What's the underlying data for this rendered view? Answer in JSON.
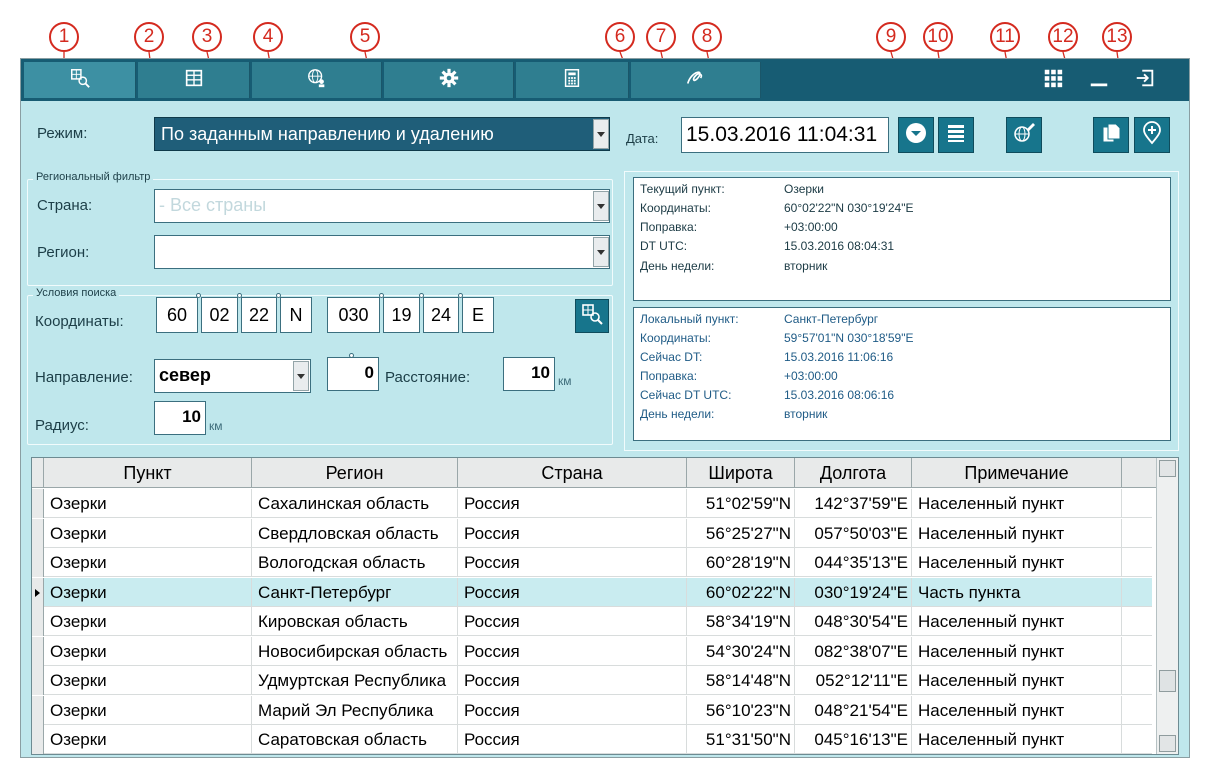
{
  "callouts": [
    "1",
    "2",
    "3",
    "4",
    "5",
    "6",
    "7",
    "8",
    "9",
    "10",
    "11",
    "12",
    "13"
  ],
  "toolbar": {
    "tabs": [
      {
        "icon": "map-search-icon",
        "active": true
      },
      {
        "icon": "table-grid-icon",
        "active": false
      },
      {
        "icon": "globe-person-icon",
        "active": false
      },
      {
        "icon": "gear-icon",
        "active": false
      },
      {
        "icon": "calculator-icon",
        "active": false
      },
      {
        "icon": "signature-icon",
        "active": false
      }
    ],
    "right": [
      "apps-grid-icon",
      "minimize-icon",
      "exit-icon"
    ]
  },
  "mode": {
    "label": "Режим:",
    "value": "По заданным направлению и удалению"
  },
  "date": {
    "label": "Дата:",
    "value": "15.03.2016 11:04:31"
  },
  "action_icons": [
    "chevron-down-circle-icon",
    "list-icon",
    "globe-edit-icon",
    "copy-icon",
    "add-location-icon"
  ],
  "regional_filter": {
    "title": "Региональный фильтр",
    "country_label": "Страна:",
    "country_placeholder": "- Все страны",
    "region_label": "Регион:",
    "region_value": ""
  },
  "search": {
    "title": "Условия поиска",
    "coords_label": "Координаты:",
    "lat": [
      "60",
      "02",
      "22",
      "N"
    ],
    "lon": [
      "030",
      "19",
      "24",
      "E"
    ],
    "direction_label": "Направление:",
    "direction_value": "север",
    "angle_value": "0",
    "distance_label": "Расстояние:",
    "distance_value": "10",
    "distance_unit": "км",
    "radius_label": "Радиус:",
    "radius_value": "10",
    "radius_unit": "км"
  },
  "current_point": [
    {
      "label": "Текущий пункт:",
      "value": "Озерки"
    },
    {
      "label": "Координаты:",
      "value": "60°02'22\"N  030°19'24\"E"
    },
    {
      "label": "Поправка:",
      "value": "+03:00:00"
    },
    {
      "label": "DT UTC:",
      "value": "15.03.2016 08:04:31"
    },
    {
      "label": "День недели:",
      "value": "вторник"
    }
  ],
  "local_point": [
    {
      "label": "Локальный пункт:",
      "value": "Санкт-Петербург"
    },
    {
      "label": "Координаты:",
      "value": "59°57'01\"N  030°18'59\"E"
    },
    {
      "label": "Сейчас DT:",
      "value": "15.03.2016 11:06:16"
    },
    {
      "label": "Поправка:",
      "value": "+03:00:00"
    },
    {
      "label": "Сейчас DT UTC:",
      "value": "15.03.2016 08:06:16"
    },
    {
      "label": "День недели:",
      "value": "вторник"
    }
  ],
  "table": {
    "columns": [
      "Пункт",
      "Регион",
      "Страна",
      "Широта",
      "Долгота",
      "Примечание"
    ],
    "rows": [
      [
        "Озерки",
        "Сахалинская область",
        "Россия",
        "51°02'59\"N",
        "142°37'59\"E",
        "Населенный пункт"
      ],
      [
        "Озерки",
        "Свердловская область",
        "Россия",
        "56°25'27\"N",
        "057°50'03\"E",
        "Населенный пункт"
      ],
      [
        "Озерки",
        "Вологодская область",
        "Россия",
        "60°28'19\"N",
        "044°35'13\"E",
        "Населенный пункт"
      ],
      [
        "Озерки",
        "Санкт-Петербург",
        "Россия",
        "60°02'22\"N",
        "030°19'24\"E",
        "Часть пункта"
      ],
      [
        "Озерки",
        "Кировская область",
        "Россия",
        "58°34'19\"N",
        "048°30'54\"E",
        "Населенный пункт"
      ],
      [
        "Озерки",
        "Новосибирская область",
        "Россия",
        "54°30'24\"N",
        "082°38'07\"E",
        "Населенный пункт"
      ],
      [
        "Озерки",
        "Удмуртская Республика",
        "Россия",
        "58°14'48\"N",
        "052°12'11\"E",
        "Населенный пункт"
      ],
      [
        "Озерки",
        "Марий Эл Республика",
        "Россия",
        "56°10'23\"N",
        "048°21'54\"E",
        "Населенный пункт"
      ],
      [
        "Озерки",
        "Саратовская область",
        "Россия",
        "51°31'50\"N",
        "045°16'13\"E",
        "Населенный пункт"
      ]
    ],
    "selected_row": 3
  },
  "colors": {
    "toolbar": "#175c73",
    "panel": "#bfe7ec",
    "callout": "#d42a1f",
    "selected_row": "#c9ecf0"
  }
}
